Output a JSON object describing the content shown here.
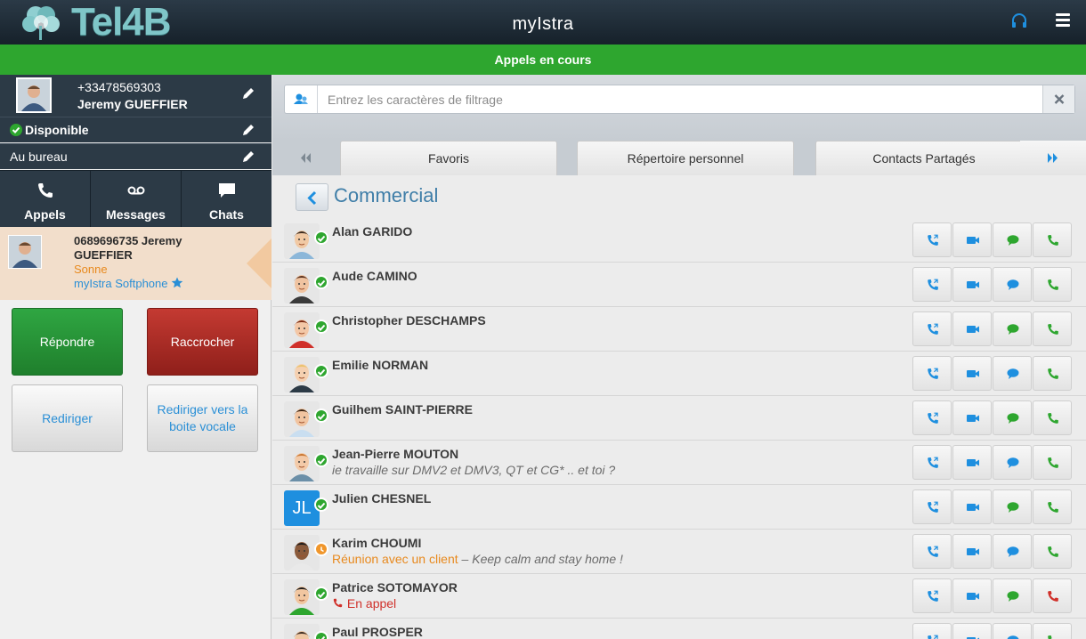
{
  "header": {
    "brand": "Tel4B",
    "title": "myIstra",
    "colors": {
      "bar": "#1f2b35",
      "accent_teal": "#7fc6c8"
    },
    "icons": [
      "tel4b-logo-icon",
      "headset-icon",
      "hamburger-menu-icon"
    ]
  },
  "banner": {
    "text": "Appels en cours",
    "color": "#2ea62f"
  },
  "user": {
    "number": "+33478569303",
    "name": "Jeremy GUEFFIER",
    "status": "Disponible",
    "location": "Au bureau"
  },
  "main_tabs": [
    {
      "label": "Appels",
      "icon": "phone-icon"
    },
    {
      "label": "Messages",
      "icon": "voicemail-icon"
    },
    {
      "label": "Chats",
      "icon": "chat-bubble-icon"
    }
  ],
  "incoming_call": {
    "caller": "0689696735 Jeremy GUEFFIER",
    "state": "Sonne",
    "device": "myIstra Softphone"
  },
  "call_buttons": {
    "answer": "Répondre",
    "hangup": "Raccrocher",
    "redirect": "Rediriger",
    "redirect_voicemail": "Rediriger vers la boite vocale"
  },
  "filter": {
    "placeholder": "Entrez les caractères de filtrage",
    "value": ""
  },
  "directory_tabs": [
    {
      "label": "Favoris"
    },
    {
      "label": "Répertoire personnel"
    },
    {
      "label": "Contacts Partagés"
    }
  ],
  "group": {
    "title": "Commercial"
  },
  "contacts": [
    {
      "name": "Alan GARIDO",
      "note": "",
      "presence": "available",
      "avatar": "man-beard-avatar-icon"
    },
    {
      "name": "Aude CAMINO",
      "note": "",
      "presence": "available",
      "avatar": "woman-brown-hair-avatar-icon"
    },
    {
      "name": "Christopher DESCHAMPS",
      "note": "",
      "presence": "available",
      "avatar": "man-red-shirt-avatar-icon"
    },
    {
      "name": "Emilie NORMAN",
      "note": "",
      "presence": "available",
      "avatar": "woman-blonde-avatar-icon"
    },
    {
      "name": "Guilhem SAINT-PIERRE",
      "note": "",
      "presence": "available",
      "avatar": "man-moustache-avatar-icon"
    },
    {
      "name": "Jean-Pierre MOUTON",
      "note": "ie travaille sur DMV2 et DMV3, QT et CG* .. et toi ?",
      "presence": "available",
      "avatar": "man-ginger-beard-avatar-icon"
    },
    {
      "name": "Julien CHESNEL",
      "note": "",
      "presence": "available",
      "initials": "JL",
      "avatar": "initials-avatar-icon"
    },
    {
      "name": "Karim CHOUMI",
      "note_status": "Réunion avec un client",
      "note_sep": " – ",
      "note": "Keep calm and stay home !",
      "presence": "away",
      "avatar": "man-glasses-suit-avatar-icon"
    },
    {
      "name": "Patrice SOTOMAYOR",
      "note_status": "En appel",
      "note": "",
      "presence": "busy",
      "avatar": "man-black-hair-avatar-icon"
    },
    {
      "name": "Paul PROSPER",
      "note": "",
      "presence": "available",
      "avatar": "man-avatar-icon"
    }
  ],
  "contact_actions": [
    "transfer-call-icon",
    "video-call-icon",
    "chat-icon",
    "call-icon"
  ],
  "colors": {
    "presence_available": "#2ea62f",
    "presence_away": "#f0962b",
    "presence_busy": "#2ea62f",
    "action_blue": "#1e8fdf",
    "action_green": "#2ea62f",
    "action_red": "#d0302a"
  }
}
